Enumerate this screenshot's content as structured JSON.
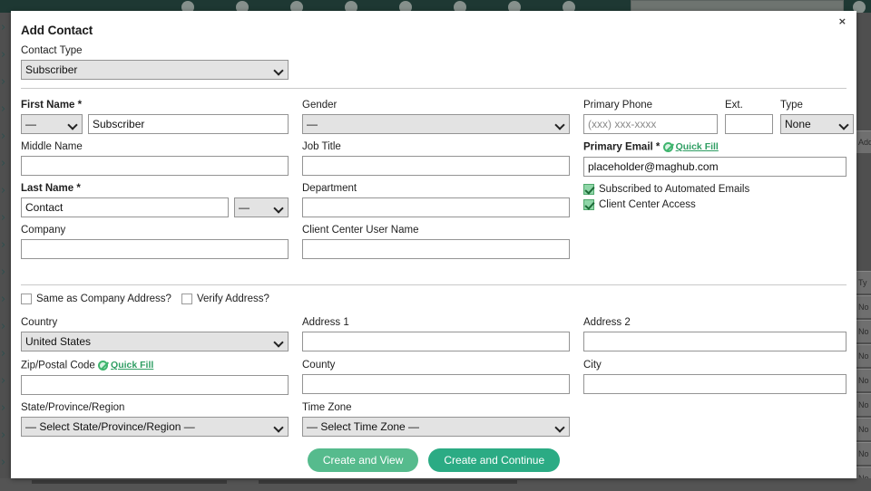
{
  "background": {
    "topbar_circles": [
      200,
      260,
      320,
      380,
      440,
      500,
      560,
      620,
      940
    ],
    "right_rail_labels": [
      "Add",
      "Ty",
      "No",
      "No",
      "No",
      "No",
      "No",
      "No",
      "No",
      "No"
    ],
    "left_rail_chevron": "›"
  },
  "modal": {
    "title": "Add Contact",
    "close_label": "×",
    "contact_type": {
      "label": "Contact Type",
      "value": "Subscriber"
    },
    "first_name": {
      "label": "First Name *",
      "prefix_value": "—",
      "value": "Subscriber"
    },
    "middle_name": {
      "label": "Middle Name",
      "value": ""
    },
    "last_name": {
      "label": "Last Name *",
      "value": "Contact",
      "suffix_value": "—"
    },
    "company": {
      "label": "Company",
      "value": ""
    },
    "gender": {
      "label": "Gender",
      "value": "—"
    },
    "job_title": {
      "label": "Job Title",
      "value": ""
    },
    "department": {
      "label": "Department",
      "value": ""
    },
    "client_center_user_name": {
      "label": "Client Center User Name",
      "value": ""
    },
    "primary_phone": {
      "label": "Primary Phone",
      "value": "",
      "placeholder": "(xxx) xxx-xxxx"
    },
    "ext": {
      "label": "Ext.",
      "value": ""
    },
    "phone_type": {
      "label": "Type",
      "value": "None"
    },
    "primary_email": {
      "label": "Primary Email *",
      "quick_fill": "Quick Fill",
      "value": "placeholder@maghub.com"
    },
    "subscribed_checkbox": {
      "label": "Subscribed to Automated Emails",
      "checked": true
    },
    "client_center_checkbox": {
      "label": "Client Center Access",
      "checked": true
    },
    "same_as_company_checkbox": {
      "label": "Same as Company Address?",
      "checked": false
    },
    "verify_address_checkbox": {
      "label": "Verify Address?",
      "checked": false
    },
    "country": {
      "label": "Country",
      "value": "United States"
    },
    "address_1": {
      "label": "Address 1",
      "value": ""
    },
    "address_2": {
      "label": "Address 2",
      "value": ""
    },
    "zip_postal_code": {
      "label": "Zip/Postal Code",
      "quick_fill": "Quick Fill",
      "value": ""
    },
    "county": {
      "label": "County",
      "value": ""
    },
    "city": {
      "label": "City",
      "value": ""
    },
    "state_province_region": {
      "label": "State/Province/Region",
      "value": "— Select State/Province/Region —"
    },
    "time_zone": {
      "label": "Time Zone",
      "value": "— Select Time Zone —"
    },
    "create_and_view_button": "Create and View",
    "create_and_continue_button": "Create and Continue"
  },
  "colors": {
    "btn_view": "#56bb8d",
    "btn_continue": "#2bab84",
    "quick_fill_green": "#2f9e63",
    "topbar_dark_green": "#1e3833",
    "overlay_gray": "#545454"
  }
}
